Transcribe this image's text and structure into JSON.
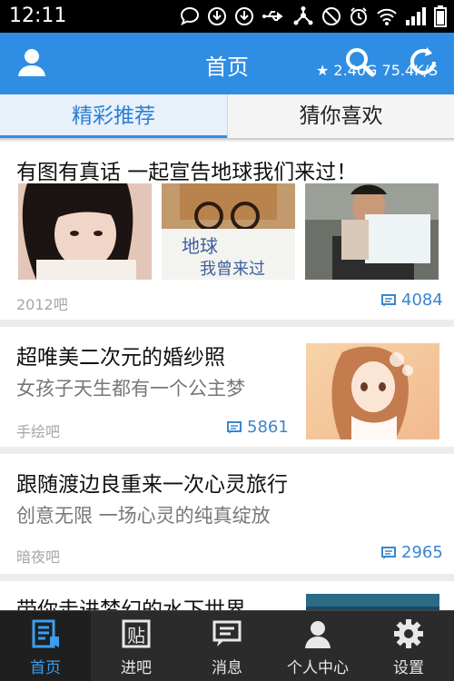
{
  "status": {
    "time": "12:11"
  },
  "header": {
    "title": "首页",
    "net_speed": "★ 2.40G 75.4K/S"
  },
  "tabs": [
    {
      "label": "精彩推荐",
      "active": true
    },
    {
      "label": "猜你喜欢",
      "active": false
    }
  ],
  "feed": [
    {
      "title": "有图有真话 一起宣告地球我们来过！",
      "forum": "2012吧",
      "reply_count": "4084",
      "sign_text_1": "地球",
      "sign_text_2": "我曾来过"
    },
    {
      "title": "超唯美二次元的婚纱照",
      "subtitle": "女孩子天生都有一个公主梦",
      "forum": "手绘吧",
      "reply_count": "5861"
    },
    {
      "title": "跟随渡边良重来一次心灵旅行",
      "subtitle": "创意无限 一场心灵的纯真绽放",
      "forum": "暗夜吧",
      "reply_count": "2965"
    },
    {
      "title": "带你走进梦幻的水下世界"
    }
  ],
  "bottom_nav": [
    {
      "label": "首页",
      "icon": "home-doc-icon",
      "active": true
    },
    {
      "label": "进吧",
      "icon": "forum-enter-icon",
      "active": false
    },
    {
      "label": "消息",
      "icon": "message-icon",
      "active": false
    },
    {
      "label": "个人中心",
      "icon": "user-icon",
      "active": false
    },
    {
      "label": "设置",
      "icon": "gear-icon",
      "active": false
    }
  ],
  "colors": {
    "brand_blue": "#2f8ee3",
    "link_blue": "#3a86cf",
    "nav_bg": "#2b2b2b"
  }
}
